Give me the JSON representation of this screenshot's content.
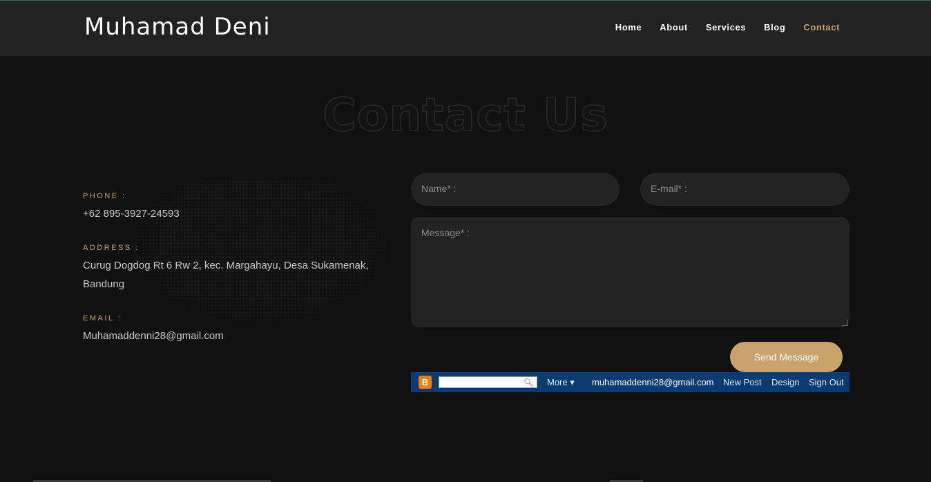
{
  "brand": "Muhamad Deni",
  "nav": [
    {
      "label": "Home"
    },
    {
      "label": "About"
    },
    {
      "label": "Services"
    },
    {
      "label": "Blog"
    },
    {
      "label": "Contact",
      "active": true
    }
  ],
  "hero_title": "Contact Us",
  "contact": {
    "phone_label": "PHONE :",
    "phone": "+62 895-3927-24593",
    "address_label": "ADDRESS :",
    "address_line1": "Curug Dogdog Rt 6 Rw 2, kec. Margahayu, Desa Sukamenak,",
    "address_line2": "Bandung",
    "email_label": "EMAIL :",
    "email": "Muhamaddenni28@gmail.com"
  },
  "form": {
    "name_placeholder": "Name* :",
    "email_placeholder": "E-mail* :",
    "message_placeholder": "Message* :",
    "send_label": "Send Message"
  },
  "blogger_bar": {
    "logo": "B",
    "more_label": "More ▾",
    "email": "muhamaddenni28@gmail.com",
    "new_post": "New Post",
    "design": "Design",
    "sign_out": "Sign Out"
  },
  "colors": {
    "accent": "#c9a36b",
    "background": "#111111",
    "header": "#222222",
    "blogger": "#0b3b73"
  }
}
